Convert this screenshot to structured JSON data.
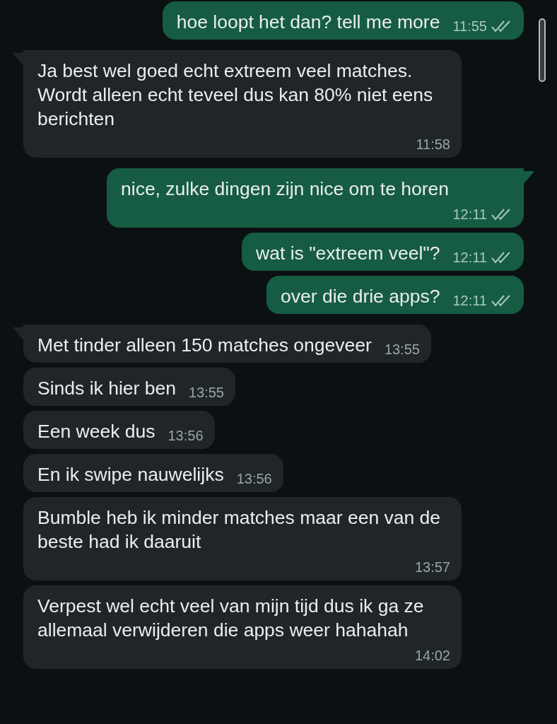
{
  "messages": [
    {
      "kind": "outgoing",
      "tail": false,
      "text": "hoe loopt het dan? tell me more",
      "time": "11:55",
      "read": false
    },
    {
      "kind": "incoming",
      "tail": true,
      "text": "Ja best wel goed echt extreem veel matches. Wordt alleen echt teveel dus kan 80% niet eens berichten",
      "time": "11:58"
    },
    {
      "kind": "outgoing",
      "tail": true,
      "text": "nice, zulke dingen zijn nice om te horen",
      "time": "12:11",
      "read": false
    },
    {
      "kind": "outgoing",
      "tail": false,
      "text": "wat is \"extreem veel\"?",
      "time": "12:11",
      "read": false
    },
    {
      "kind": "outgoing",
      "tail": false,
      "text": "over die drie apps?",
      "time": "12:11",
      "read": false
    },
    {
      "kind": "incoming",
      "tail": true,
      "text": "Met tinder alleen 150 matches ongeveer",
      "time": "13:55"
    },
    {
      "kind": "incoming",
      "tail": false,
      "text": "Sinds ik hier ben",
      "time": "13:55"
    },
    {
      "kind": "incoming",
      "tail": false,
      "text": "Een week dus",
      "time": "13:56"
    },
    {
      "kind": "incoming",
      "tail": false,
      "text": "En ik swipe nauwelijks",
      "time": "13:56"
    },
    {
      "kind": "incoming",
      "tail": false,
      "text": "Bumble heb ik minder matches maar een van de beste had ik daaruit",
      "time": "13:57"
    },
    {
      "kind": "incoming",
      "tail": false,
      "text": "Verpest wel echt veel van mijn tijd dus ik ga ze allemaal verwijderen die apps weer hahahah",
      "time": "14:02"
    }
  ]
}
